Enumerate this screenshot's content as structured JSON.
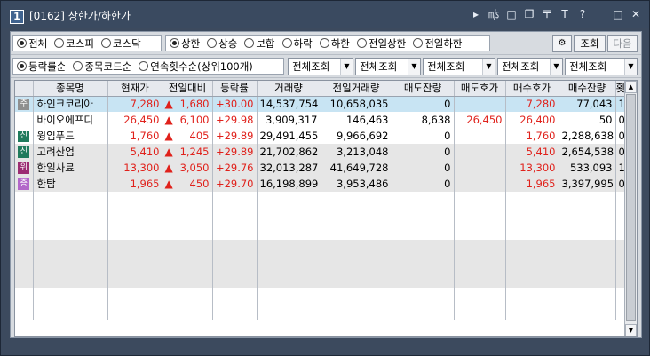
{
  "window": {
    "number": "1",
    "title": "[0162] 상한가/하한가",
    "controls": [
      "▸",
      "㎧",
      "□",
      "❐",
      "〒",
      "T",
      "?",
      "_",
      "□",
      "✕"
    ]
  },
  "market_filter": {
    "options": [
      "전체",
      "코스피",
      "코스닥"
    ],
    "selected": "전체"
  },
  "limit_filter": {
    "options": [
      "상한",
      "상승",
      "보합",
      "하락",
      "하한",
      "전일상한",
      "전일하한"
    ],
    "selected": "상한"
  },
  "buttons": {
    "settings_icon": "⚙",
    "search": "조회",
    "next": "다음"
  },
  "sort_filter": {
    "options": [
      "등락률순",
      "종목코드순",
      "연속횟수순(상위100개)"
    ],
    "selected": "등락률순"
  },
  "dropdowns": [
    "전체조회",
    "전체조회",
    "전체조회",
    "전체조회",
    "전체조회"
  ],
  "table": {
    "columns": [
      "",
      "종목명",
      "현재가",
      "전일대비",
      "등락률",
      "거래량",
      "전일거래량",
      "매도잔량",
      "매도호가",
      "매수호가",
      "매수잔량",
      "횟수"
    ],
    "rows": [
      {
        "tag": "주",
        "tag_color": "#8f8f8f",
        "name": "하인크코리아",
        "price": "7,280",
        "change": "1,680",
        "rate": "+30.00",
        "volume": "14,537,754",
        "prev_volume": "10,658,035",
        "ask_qty": "0",
        "ask_price": "",
        "bid_price": "7,280",
        "bid_qty": "77,043",
        "count": "1"
      },
      {
        "tag": "",
        "tag_color": "",
        "name": "바이오에프디",
        "price": "26,450",
        "change": "6,100",
        "rate": "+29.98",
        "volume": "3,909,317",
        "prev_volume": "146,463",
        "ask_qty": "8,638",
        "ask_price": "26,450",
        "bid_price": "26,400",
        "bid_qty": "50",
        "count": "0"
      },
      {
        "tag": "신",
        "tag_color": "#1f7a5c",
        "name": "윙입푸드",
        "price": "1,760",
        "change": "405",
        "rate": "+29.89",
        "volume": "29,491,455",
        "prev_volume": "9,966,692",
        "ask_qty": "0",
        "ask_price": "",
        "bid_price": "1,760",
        "bid_qty": "2,288,638",
        "count": "0"
      },
      {
        "tag": "신",
        "tag_color": "#1f7a5c",
        "name": "고려산업",
        "price": "5,410",
        "change": "1,245",
        "rate": "+29.89",
        "volume": "21,702,862",
        "prev_volume": "3,213,048",
        "ask_qty": "0",
        "ask_price": "",
        "bid_price": "5,410",
        "bid_qty": "2,654,538",
        "count": "0"
      },
      {
        "tag": "위",
        "tag_color": "#9b2c72",
        "name": "한일사료",
        "price": "13,300",
        "change": "3,050",
        "rate": "+29.76",
        "volume": "32,013,287",
        "prev_volume": "41,649,728",
        "ask_qty": "0",
        "ask_price": "",
        "bid_price": "13,300",
        "bid_qty": "533,093",
        "count": "1"
      },
      {
        "tag": "증",
        "tag_color": "#b266c9",
        "name": "한탑",
        "price": "1,965",
        "change": "450",
        "rate": "+29.70",
        "volume": "16,198,899",
        "prev_volume": "3,953,486",
        "ask_qty": "0",
        "ask_price": "",
        "bid_price": "1,965",
        "bid_qty": "3,397,995",
        "count": "0"
      }
    ],
    "up_arrow": "🡅"
  },
  "colors": {
    "up": "#e0211b",
    "selected_row": "#c8e4f3",
    "alt_row": "#e6e6e6"
  }
}
